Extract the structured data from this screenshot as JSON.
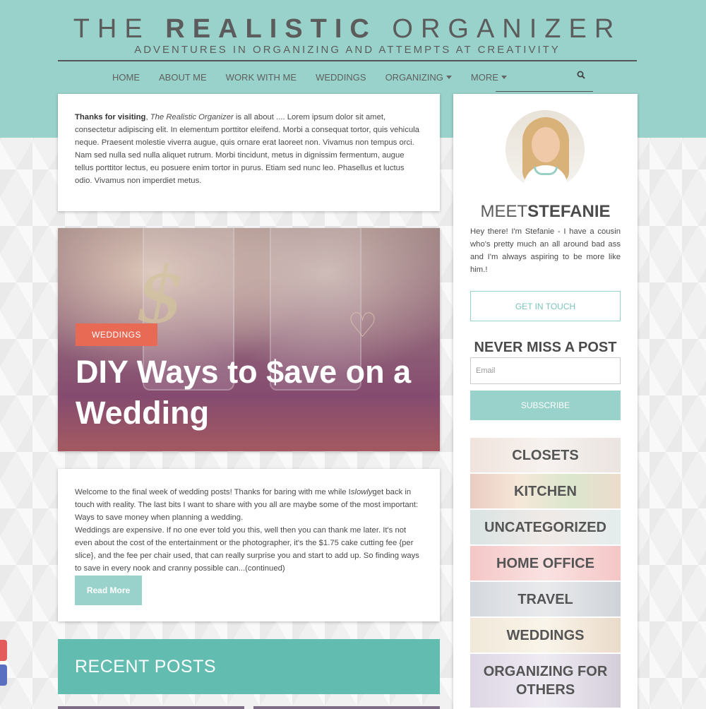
{
  "header": {
    "title_pre": "THE",
    "title_bold": "REALISTIC",
    "title_post": "ORGANIZER",
    "tagline": "ADVENTURES IN ORGANIZING AND ATTEMPTS AT CREATIVITY"
  },
  "nav": {
    "items": [
      "HOME",
      "ABOUT ME",
      "WORK WITH ME",
      "WEDDINGS",
      "ORGANIZING",
      "MORE"
    ],
    "search_icon": "search-icon"
  },
  "intro": {
    "bold": "Thanks for visiting",
    "comma": ", ",
    "italic": "The Realistic Organizer",
    "rest": " is all about .... Lorem ipsum dolor sit amet, consectetur adipiscing elit. In elementum porttitor eleifend. Morbi a consequat tortor, quis vehicula neque. Praesent molestie viverra augue, quis ornare erat laoreet non. Vivamus non tempus orci. Nam sed nulla sed nulla aliquet rutrum. Morbi tincidunt, metus in dignissim fermentum, augue tellus porttitor lectus, eu posuere enim tortor in purus. Etiam sed nunc leo. Phasellus et luctus odio. Vivamus non imperdiet metus."
  },
  "feature": {
    "category": "WEDDINGS",
    "title": "DIY Ways to $ave on a Wedding"
  },
  "excerpt": {
    "p1_a": "Welcome to the final week of wedding posts! Thanks for baring with me while I",
    "p1_italic": "slowly",
    "p1_b": "get back in touch with reality. The last bits I want to share with you all are maybe some of the most important: Ways to save money when planning a wedding.",
    "p2": "Weddings are expensive. If no one ever told you this, well then you can thank me later. It's not even about the cost of the entertainment or the photographer, it's the $1.75 cake cutting fee {per slice}, and the fee per chair used, that can really surprise you and start to add up. So finding ways to save in every nook and cranny possible can...(continued)",
    "read_more": "Read More"
  },
  "recent": {
    "title": "RECENT POSTS"
  },
  "sidebar": {
    "meet_light": "MEET",
    "meet_bold": "STEFANIE",
    "bio": "Hey there! I'm Stefanie - I have a cousin who's pretty much an all around bad ass and I'm always aspiring to be more like him.!",
    "get_in_touch": "GET IN TOUCH",
    "never_miss": "NEVER MISS A POST",
    "email_placeholder": "Email",
    "subscribe": "SUBSCRIBE",
    "categories": [
      "CLOSETS",
      "KITCHEN",
      "UNCATEGORIZED",
      "HOME OFFICE",
      "TRAVEL",
      "WEDDINGS",
      "ORGANIZING FOR OTHERS"
    ]
  },
  "colors": {
    "teal_light": "#99d2cb",
    "teal_dark": "#63bcb0",
    "coral": "#e86a55"
  }
}
